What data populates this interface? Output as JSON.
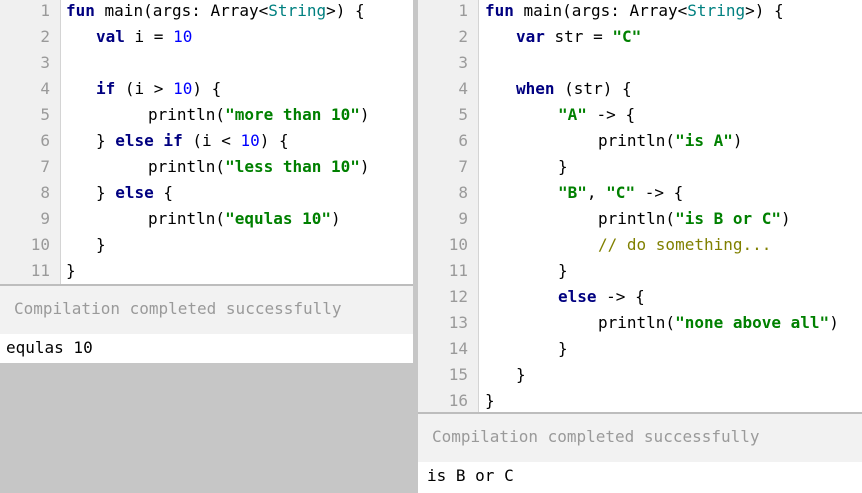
{
  "left": {
    "line_numbers": [
      "1",
      "2",
      "3",
      "4",
      "5",
      "6",
      "7",
      "8",
      "9",
      "10",
      "11"
    ],
    "code": {
      "l1_kw": "fun",
      "l1_rest": " main(args: Array<",
      "l1_type": "String",
      "l1_tail": ">) {",
      "l2_kw": "val",
      "l2_mid": " i = ",
      "l2_num": "10",
      "l4_kw": "if",
      "l4_mid": " (i > ",
      "l4_num": "10",
      "l4_tail": ") {",
      "l5_fn": "println(",
      "l5_str": "\"more than 10\"",
      "l5_tail": ")",
      "l6_pre": "} ",
      "l6_kw": "else if",
      "l6_mid": " (i < ",
      "l6_num": "10",
      "l6_tail": ") {",
      "l7_fn": "println(",
      "l7_str": "\"less than 10\"",
      "l7_tail": ")",
      "l8_pre": "} ",
      "l8_kw": "else",
      "l8_tail": " {",
      "l9_fn": "println(",
      "l9_str": "\"equlas 10\"",
      "l9_tail": ")",
      "l10": "}",
      "l11": "}"
    },
    "status": "Compilation completed successfully",
    "output": "equlas 10"
  },
  "right": {
    "line_numbers": [
      "1",
      "2",
      "3",
      "4",
      "5",
      "6",
      "7",
      "8",
      "9",
      "10",
      "11",
      "12",
      "13",
      "14",
      "15",
      "16"
    ],
    "code": {
      "l1_kw": "fun",
      "l1_rest": " main(args: Array<",
      "l1_type": "String",
      "l1_tail": ">) {",
      "l2_kw": "var",
      "l2_mid": " str = ",
      "l2_str": "\"C\"",
      "l4_kw": "when",
      "l4_tail": " (str) {",
      "l5_str": "\"A\"",
      "l5_tail": " -> {",
      "l6_fn": "println(",
      "l6_str": "\"is A\"",
      "l6_tail": ")",
      "l7": "}",
      "l8_str1": "\"B\"",
      "l8_mid": ", ",
      "l8_str2": "\"C\"",
      "l8_tail": " -> {",
      "l9_fn": "println(",
      "l9_str": "\"is B or C\"",
      "l9_tail": ")",
      "l10_cmt": "// do something...",
      "l11": "}",
      "l12_kw": "else",
      "l12_tail": " -> {",
      "l13_fn": "println(",
      "l13_str": "\"none above all\"",
      "l13_tail": ")",
      "l14": "}",
      "l15": "}",
      "l16": "}"
    },
    "status": "Compilation completed successfully",
    "output": "is B or C"
  }
}
